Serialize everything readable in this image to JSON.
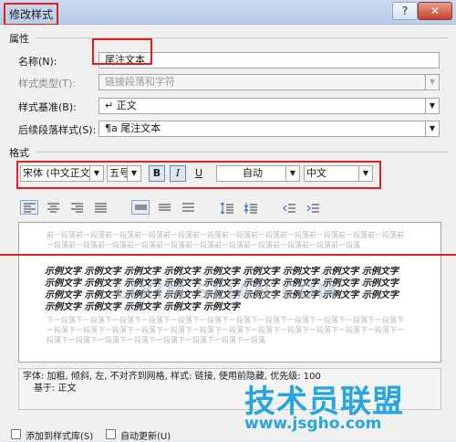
{
  "window": {
    "title": "修改样式",
    "help_label": "?",
    "close_label": "✕"
  },
  "properties": {
    "heading": "属性",
    "name_label": "名称(N):",
    "name_value": "尾注文本",
    "style_type_label": "样式类型(T):",
    "style_type_value": "链接段落和字符",
    "based_on_label": "样式基准(B):",
    "based_on_value": "↵ 正文",
    "following_label": "后续段落样式(S):",
    "following_value": "¶a 尾注文本"
  },
  "format": {
    "heading": "格式",
    "font": "宋体 (中文正文)",
    "size": "五号",
    "bold_label": "B",
    "italic_label": "I",
    "underline_label": "U",
    "color": "自动",
    "script": "中文"
  },
  "preview": {
    "prev_para": "前一段落前一段落前一段落前一段落前一段落前一段落前一段落前一段落前一段落前一段落前一段落前一段落前一段落前一段落前一段落前一段落前一段落前一段落前一段落前一段落前一段落前一段落前一段落",
    "sample": "示例文字 示例文字 示例文字 示例文字 示例文字 示例文字 示例文字 示例文字 示例文字 示例文字 示例文字 示例文字 示例文字 示例文字 示例文字 示例文字 示例文字 示例文字 示例文字 示例文字 示例文字 示例文字 示例文字 示例文字 示例文字 示例文字 示例文字 示例文字 示例文字 示例文字 示例文字 示例文字",
    "next_para": "下一段落下一段落下一段落下一段落下一段落下一段落下一段落下一段落下一段落下一段落下一段落下一段落下一段落下一段落下一段落下一段落下一段落下一段落下一段落下一段落下一段落下一段落下一段落下一段落下一段落下一段落下一段落下一段落下一段落下一段落下一段落下一段落"
  },
  "description": {
    "line1": "字体: 加粗, 倾斜, 左, 不对齐到网格, 样式: 链接, 使用前隐藏, 优先级: 100",
    "line2": "基于: 正文"
  },
  "options": {
    "add_to_gallery": "添加到样式库(S)",
    "auto_update": "自动更新(U)"
  },
  "watermark": {
    "site": "LIXIM SLIAN.COM",
    "brand": "技术员联盟",
    "url": "www.jsgho.com"
  },
  "colors": {
    "annotation_red": "#e02020",
    "brand_blue": "#27a5e2"
  }
}
